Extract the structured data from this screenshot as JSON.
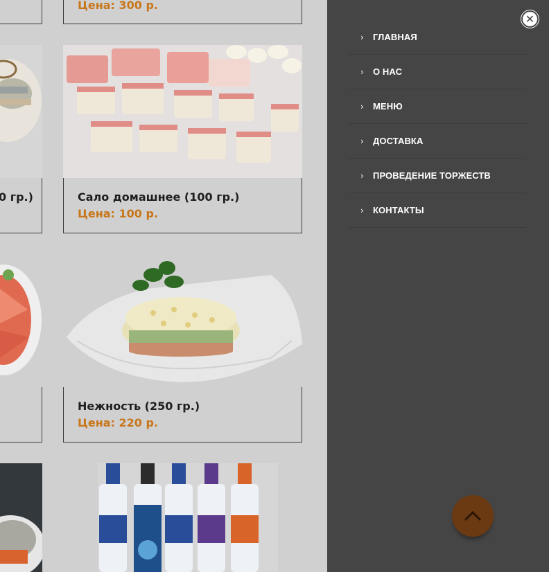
{
  "products": [
    {
      "title": "",
      "price": "Цена: 300 р."
    },
    {
      "title": "0 гр.)",
      "price": ""
    },
    {
      "title": "Сало домашнее (100 гр.)",
      "price": "Цена: 100 р."
    },
    {
      "title": "Нежность (250 гр.)",
      "price": "Цена: 220 р."
    }
  ],
  "menu": {
    "items": [
      {
        "label": "ГЛАВНАЯ"
      },
      {
        "label": "О НАС"
      },
      {
        "label": "МЕНЮ"
      },
      {
        "label": "ДОСТАВКА"
      },
      {
        "label": "ПРОВЕДЕНИЕ ТОРЖЕСТВ"
      },
      {
        "label": "КОНТАКТЫ"
      }
    ]
  },
  "icons": {
    "close": "close-icon",
    "chevron": "chevron-right-icon",
    "scroll_top": "chevron-up-icon"
  },
  "colors": {
    "drawer_bg": "#454545",
    "price": "#c8761a",
    "scroll_top_bg": "#6b3a12"
  }
}
